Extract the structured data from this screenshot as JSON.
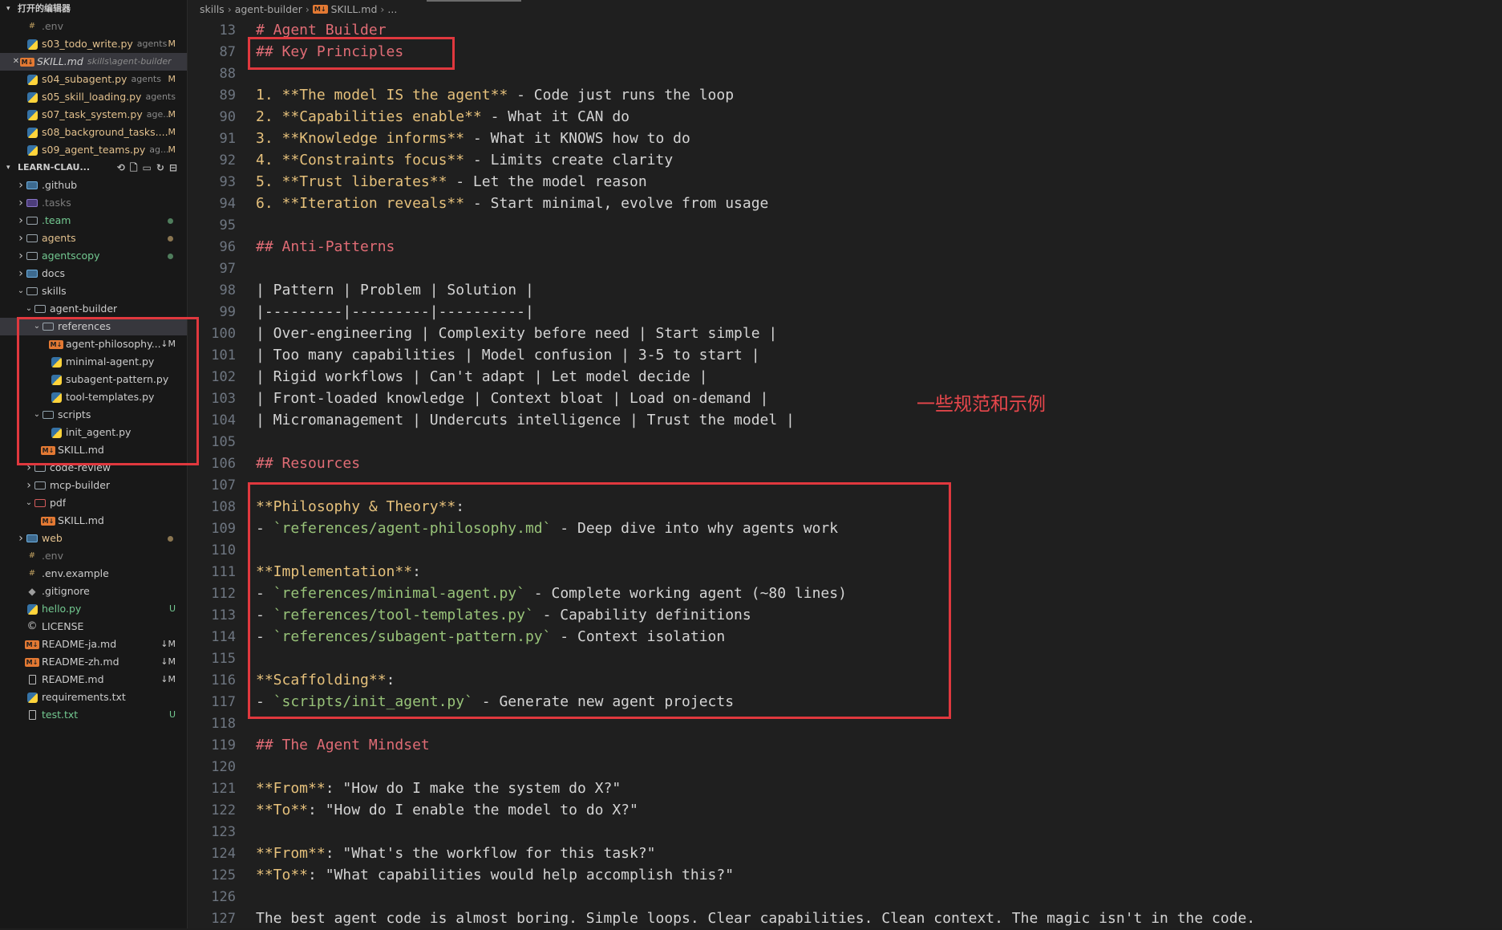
{
  "open_editors": {
    "title": "打开的编辑器",
    "items": [
      {
        "name": ".env",
        "desc": "",
        "badge": "",
        "icon": "env-icon",
        "state": "muted"
      },
      {
        "name": "s03_todo_write.py",
        "desc": "agents",
        "badge": "M",
        "icon": "python-file-icon",
        "state": "mod"
      },
      {
        "name": "SKILL.md",
        "desc": "skills\\agent-builder",
        "badge": "",
        "icon": "markdown-file-icon",
        "state": "active"
      },
      {
        "name": "s04_subagent.py",
        "desc": "agents",
        "badge": "M",
        "icon": "python-file-icon",
        "state": "mod"
      },
      {
        "name": "s05_skill_loading.py",
        "desc": "agents",
        "badge": "",
        "icon": "python-file-icon",
        "state": "plain"
      },
      {
        "name": "s07_task_system.py",
        "desc": "age...",
        "badge": "M",
        "icon": "python-file-icon",
        "state": "mod"
      },
      {
        "name": "s08_background_tasks....",
        "desc": "",
        "badge": "M",
        "icon": "python-file-icon",
        "state": "mod"
      },
      {
        "name": "s09_agent_teams.py",
        "desc": "ag...",
        "badge": "M",
        "icon": "python-file-icon",
        "state": "mod"
      }
    ]
  },
  "explorer": {
    "title": "LEARN-CLAU...",
    "tree": [
      {
        "name": ".github",
        "level": 0,
        "twist": "closed",
        "icon": "folder-github-icon",
        "color": "white",
        "mark": ""
      },
      {
        "name": ".tasks",
        "level": 0,
        "twist": "closed",
        "icon": "folder-tasks-icon",
        "color": "muted",
        "mark": ""
      },
      {
        "name": ".team",
        "level": 0,
        "twist": "closed",
        "icon": "folder-icon",
        "color": "green",
        "mark": "dot"
      },
      {
        "name": "agents",
        "level": 0,
        "twist": "closed",
        "icon": "folder-icon",
        "color": "mod",
        "mark": "dot"
      },
      {
        "name": "agentscopy",
        "level": 0,
        "twist": "closed",
        "icon": "folder-icon",
        "color": "green",
        "mark": "dot"
      },
      {
        "name": "docs",
        "level": 0,
        "twist": "closed",
        "icon": "folder-docs-icon",
        "color": "white",
        "mark": ""
      },
      {
        "name": "skills",
        "level": 0,
        "twist": "open",
        "icon": "folder-icon",
        "color": "white",
        "mark": ""
      },
      {
        "name": "agent-builder",
        "level": 1,
        "twist": "open",
        "icon": "folder-icon",
        "color": "white",
        "mark": ""
      },
      {
        "name": "references",
        "level": 2,
        "twist": "open",
        "icon": "folder-icon",
        "color": "white",
        "mark": "",
        "selected": true
      },
      {
        "name": "agent-philosophy...",
        "level": 3,
        "twist": "",
        "icon": "markdown-file-icon",
        "color": "white",
        "mark": "↓M"
      },
      {
        "name": "minimal-agent.py",
        "level": 3,
        "twist": "",
        "icon": "python-file-icon",
        "color": "white",
        "mark": ""
      },
      {
        "name": "subagent-pattern.py",
        "level": 3,
        "twist": "",
        "icon": "python-file-icon",
        "color": "white",
        "mark": ""
      },
      {
        "name": "tool-templates.py",
        "level": 3,
        "twist": "",
        "icon": "python-file-icon",
        "color": "white",
        "mark": ""
      },
      {
        "name": "scripts",
        "level": 2,
        "twist": "open",
        "icon": "folder-scripts-icon",
        "color": "white",
        "mark": ""
      },
      {
        "name": "init_agent.py",
        "level": 3,
        "twist": "",
        "icon": "python-file-icon",
        "color": "white",
        "mark": ""
      },
      {
        "name": "SKILL.md",
        "level": 2,
        "twist": "",
        "icon": "markdown-file-icon",
        "color": "white",
        "mark": ""
      },
      {
        "name": "code-review",
        "level": 1,
        "twist": "closed",
        "icon": "folder-icon",
        "color": "white",
        "mark": ""
      },
      {
        "name": "mcp-builder",
        "level": 1,
        "twist": "closed",
        "icon": "folder-icon",
        "color": "white",
        "mark": ""
      },
      {
        "name": "pdf",
        "level": 1,
        "twist": "open",
        "icon": "folder-pdf-icon",
        "color": "white",
        "mark": ""
      },
      {
        "name": "SKILL.md",
        "level": 2,
        "twist": "",
        "icon": "markdown-file-icon",
        "color": "white",
        "mark": ""
      },
      {
        "name": "web",
        "level": 0,
        "twist": "closed",
        "icon": "folder-web-icon",
        "color": "mod",
        "mark": "dot"
      },
      {
        "name": ".env",
        "level": 0,
        "twist": "",
        "icon": "env-icon",
        "color": "muted",
        "mark": ""
      },
      {
        "name": ".env.example",
        "level": 0,
        "twist": "",
        "icon": "env-icon",
        "color": "white",
        "mark": ""
      },
      {
        "name": ".gitignore",
        "level": 0,
        "twist": "",
        "icon": "git-icon",
        "color": "white",
        "mark": ""
      },
      {
        "name": "hello.py",
        "level": 0,
        "twist": "",
        "icon": "python-file-icon",
        "color": "green",
        "mark": "U"
      },
      {
        "name": "LICENSE",
        "level": 0,
        "twist": "",
        "icon": "license-icon",
        "color": "white",
        "mark": ""
      },
      {
        "name": "README-ja.md",
        "level": 0,
        "twist": "",
        "icon": "markdown-file-icon",
        "color": "white",
        "mark": "↓M"
      },
      {
        "name": "README-zh.md",
        "level": 0,
        "twist": "",
        "icon": "markdown-file-icon",
        "color": "white",
        "mark": "↓M"
      },
      {
        "name": "README.md",
        "level": 0,
        "twist": "",
        "icon": "readme-icon",
        "color": "white",
        "mark": "↓M"
      },
      {
        "name": "requirements.txt",
        "level": 0,
        "twist": "",
        "icon": "requirements-icon",
        "color": "white",
        "mark": ""
      },
      {
        "name": "test.txt",
        "level": 0,
        "twist": "",
        "icon": "text-file-icon",
        "color": "green",
        "mark": "U"
      }
    ]
  },
  "breadcrumb": [
    "skills",
    "agent-builder",
    "SKILL.md",
    "..."
  ],
  "code_lines": [
    {
      "n": "13",
      "tokens": [
        [
          "h",
          "# Agent Builder"
        ]
      ]
    },
    {
      "n": "87",
      "tokens": [
        [
          "h",
          "## Key Principles"
        ]
      ]
    },
    {
      "n": "88",
      "tokens": []
    },
    {
      "n": "89",
      "tokens": [
        [
          "n",
          "1. "
        ],
        [
          "b",
          "**The model IS the agent**"
        ],
        [
          "t",
          " - Code just runs the loop"
        ]
      ]
    },
    {
      "n": "90",
      "tokens": [
        [
          "n",
          "2. "
        ],
        [
          "b",
          "**Capabilities enable**"
        ],
        [
          "t",
          " - What it CAN do"
        ]
      ]
    },
    {
      "n": "91",
      "tokens": [
        [
          "n",
          "3. "
        ],
        [
          "b",
          "**Knowledge informs**"
        ],
        [
          "t",
          " - What it KNOWS how to do"
        ]
      ]
    },
    {
      "n": "92",
      "tokens": [
        [
          "n",
          "4. "
        ],
        [
          "b",
          "**Constraints focus**"
        ],
        [
          "t",
          " - Limits create clarity"
        ]
      ]
    },
    {
      "n": "93",
      "tokens": [
        [
          "n",
          "5. "
        ],
        [
          "b",
          "**Trust liberates**"
        ],
        [
          "t",
          " - Let the model reason"
        ]
      ]
    },
    {
      "n": "94",
      "tokens": [
        [
          "n",
          "6. "
        ],
        [
          "b",
          "**Iteration reveals**"
        ],
        [
          "t",
          " - Start minimal, evolve from usage"
        ]
      ]
    },
    {
      "n": "95",
      "tokens": []
    },
    {
      "n": "96",
      "tokens": [
        [
          "h",
          "## Anti-Patterns"
        ]
      ]
    },
    {
      "n": "97",
      "tokens": []
    },
    {
      "n": "98",
      "tokens": [
        [
          "t",
          "| Pattern | Problem | Solution |"
        ]
      ]
    },
    {
      "n": "99",
      "tokens": [
        [
          "t",
          "|---------|---------|----------|"
        ]
      ]
    },
    {
      "n": "100",
      "tokens": [
        [
          "t",
          "| Over-engineering | Complexity before need | Start simple |"
        ]
      ]
    },
    {
      "n": "101",
      "tokens": [
        [
          "t",
          "| Too many capabilities | Model confusion | 3-5 to start |"
        ]
      ]
    },
    {
      "n": "102",
      "tokens": [
        [
          "t",
          "| Rigid workflows | Can't adapt | Let model decide |"
        ]
      ]
    },
    {
      "n": "103",
      "tokens": [
        [
          "t",
          "| Front-loaded knowledge | Context bloat | Load on-demand |"
        ]
      ]
    },
    {
      "n": "104",
      "tokens": [
        [
          "t",
          "| Micromanagement | Undercuts intelligence | Trust the model |"
        ]
      ]
    },
    {
      "n": "105",
      "tokens": []
    },
    {
      "n": "106",
      "tokens": [
        [
          "h",
          "## Resources"
        ]
      ]
    },
    {
      "n": "107",
      "tokens": []
    },
    {
      "n": "108",
      "tokens": [
        [
          "b",
          "**Philosophy & Theory**"
        ],
        [
          "t",
          ":"
        ]
      ]
    },
    {
      "n": "109",
      "tokens": [
        [
          "t",
          "- "
        ],
        [
          "c",
          "`references/agent-philosophy.md`"
        ],
        [
          "t",
          " - Deep dive into why agents work"
        ]
      ]
    },
    {
      "n": "110",
      "tokens": []
    },
    {
      "n": "111",
      "tokens": [
        [
          "b",
          "**Implementation**"
        ],
        [
          "t",
          ":"
        ]
      ]
    },
    {
      "n": "112",
      "tokens": [
        [
          "t",
          "- "
        ],
        [
          "c",
          "`references/minimal-agent.py`"
        ],
        [
          "t",
          " - Complete working agent (~80 lines)"
        ]
      ]
    },
    {
      "n": "113",
      "tokens": [
        [
          "t",
          "- "
        ],
        [
          "c",
          "`references/tool-templates.py`"
        ],
        [
          "t",
          " - Capability definitions"
        ]
      ]
    },
    {
      "n": "114",
      "tokens": [
        [
          "t",
          "- "
        ],
        [
          "c",
          "`references/subagent-pattern.py`"
        ],
        [
          "t",
          " - Context isolation"
        ]
      ]
    },
    {
      "n": "115",
      "tokens": []
    },
    {
      "n": "116",
      "tokens": [
        [
          "b",
          "**Scaffolding**"
        ],
        [
          "t",
          ":"
        ]
      ]
    },
    {
      "n": "117",
      "tokens": [
        [
          "t",
          "- "
        ],
        [
          "c",
          "`scripts/init_agent.py`"
        ],
        [
          "t",
          " - Generate new agent projects"
        ]
      ]
    },
    {
      "n": "118",
      "tokens": []
    },
    {
      "n": "119",
      "tokens": [
        [
          "h",
          "## The Agent Mindset"
        ]
      ]
    },
    {
      "n": "120",
      "tokens": []
    },
    {
      "n": "121",
      "tokens": [
        [
          "b",
          "**From**"
        ],
        [
          "t",
          ": \"How do I make the system do X?\""
        ]
      ]
    },
    {
      "n": "122",
      "tokens": [
        [
          "b",
          "**To**"
        ],
        [
          "t",
          ": \"How do I enable the model to do X?\""
        ]
      ]
    },
    {
      "n": "123",
      "tokens": []
    },
    {
      "n": "124",
      "tokens": [
        [
          "b",
          "**From**"
        ],
        [
          "t",
          ": \"What's the workflow for this task?\""
        ]
      ]
    },
    {
      "n": "125",
      "tokens": [
        [
          "b",
          "**To**"
        ],
        [
          "t",
          ": \"What capabilities would help accomplish this?\""
        ]
      ]
    },
    {
      "n": "126",
      "tokens": []
    },
    {
      "n": "127",
      "tokens": [
        [
          "t",
          "The best agent code is almost boring. Simple loops. Clear capabilities. Clean context. The magic isn't in the code."
        ]
      ]
    }
  ],
  "annotation_note": "一些规范和示例",
  "colors": {
    "annotation": "#e0383e",
    "modified": "#e2c08d",
    "untracked": "#73c991",
    "heading": "#e06c75",
    "bold": "#e5c07b",
    "code": "#98c379"
  }
}
